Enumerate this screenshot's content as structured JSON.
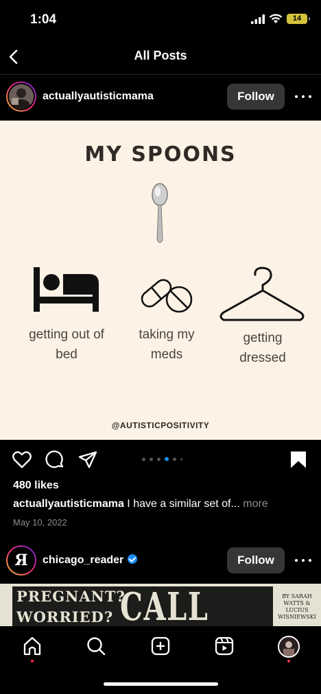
{
  "status_bar": {
    "time": "1:04",
    "battery": "14"
  },
  "header": {
    "title": "All Posts"
  },
  "post1": {
    "username": "actuallyautisticmama",
    "follow_label": "Follow",
    "image": {
      "title": "MY SPOONS",
      "captions": [
        "getting out of bed",
        "taking my meds",
        "getting dressed"
      ],
      "caption_lines": [
        [
          "getting out of",
          "bed"
        ],
        [
          "taking my",
          "meds"
        ],
        [
          "getting",
          "dressed"
        ]
      ],
      "credit": "@AUTISTICPOSITIVITY"
    },
    "carousel": {
      "count": 6,
      "active_index": 3
    },
    "likes": "480 likes",
    "caption_user": "actuallyautisticmama",
    "caption_text": " I have a similar set of...",
    "caption_more": " more",
    "date": "May 10, 2022"
  },
  "post2": {
    "username": "chicago_reader",
    "verified": true,
    "follow_label": "Follow",
    "banner": {
      "line1": "PREGNANT?",
      "line2": "WORRIED?",
      "headline": "CALL JANE",
      "byline": "BY SARAH WATTS & LUCIUS WISNIEWSKI"
    }
  },
  "tabbar": {
    "items": [
      "home-icon",
      "search-icon",
      "create-icon",
      "reels-icon",
      "profile-avatar"
    ]
  },
  "colors": {
    "accent": "#1d8cf5",
    "notification": "#ff3040",
    "image_bg": "#fdf2e6",
    "button_bg": "#363636"
  }
}
